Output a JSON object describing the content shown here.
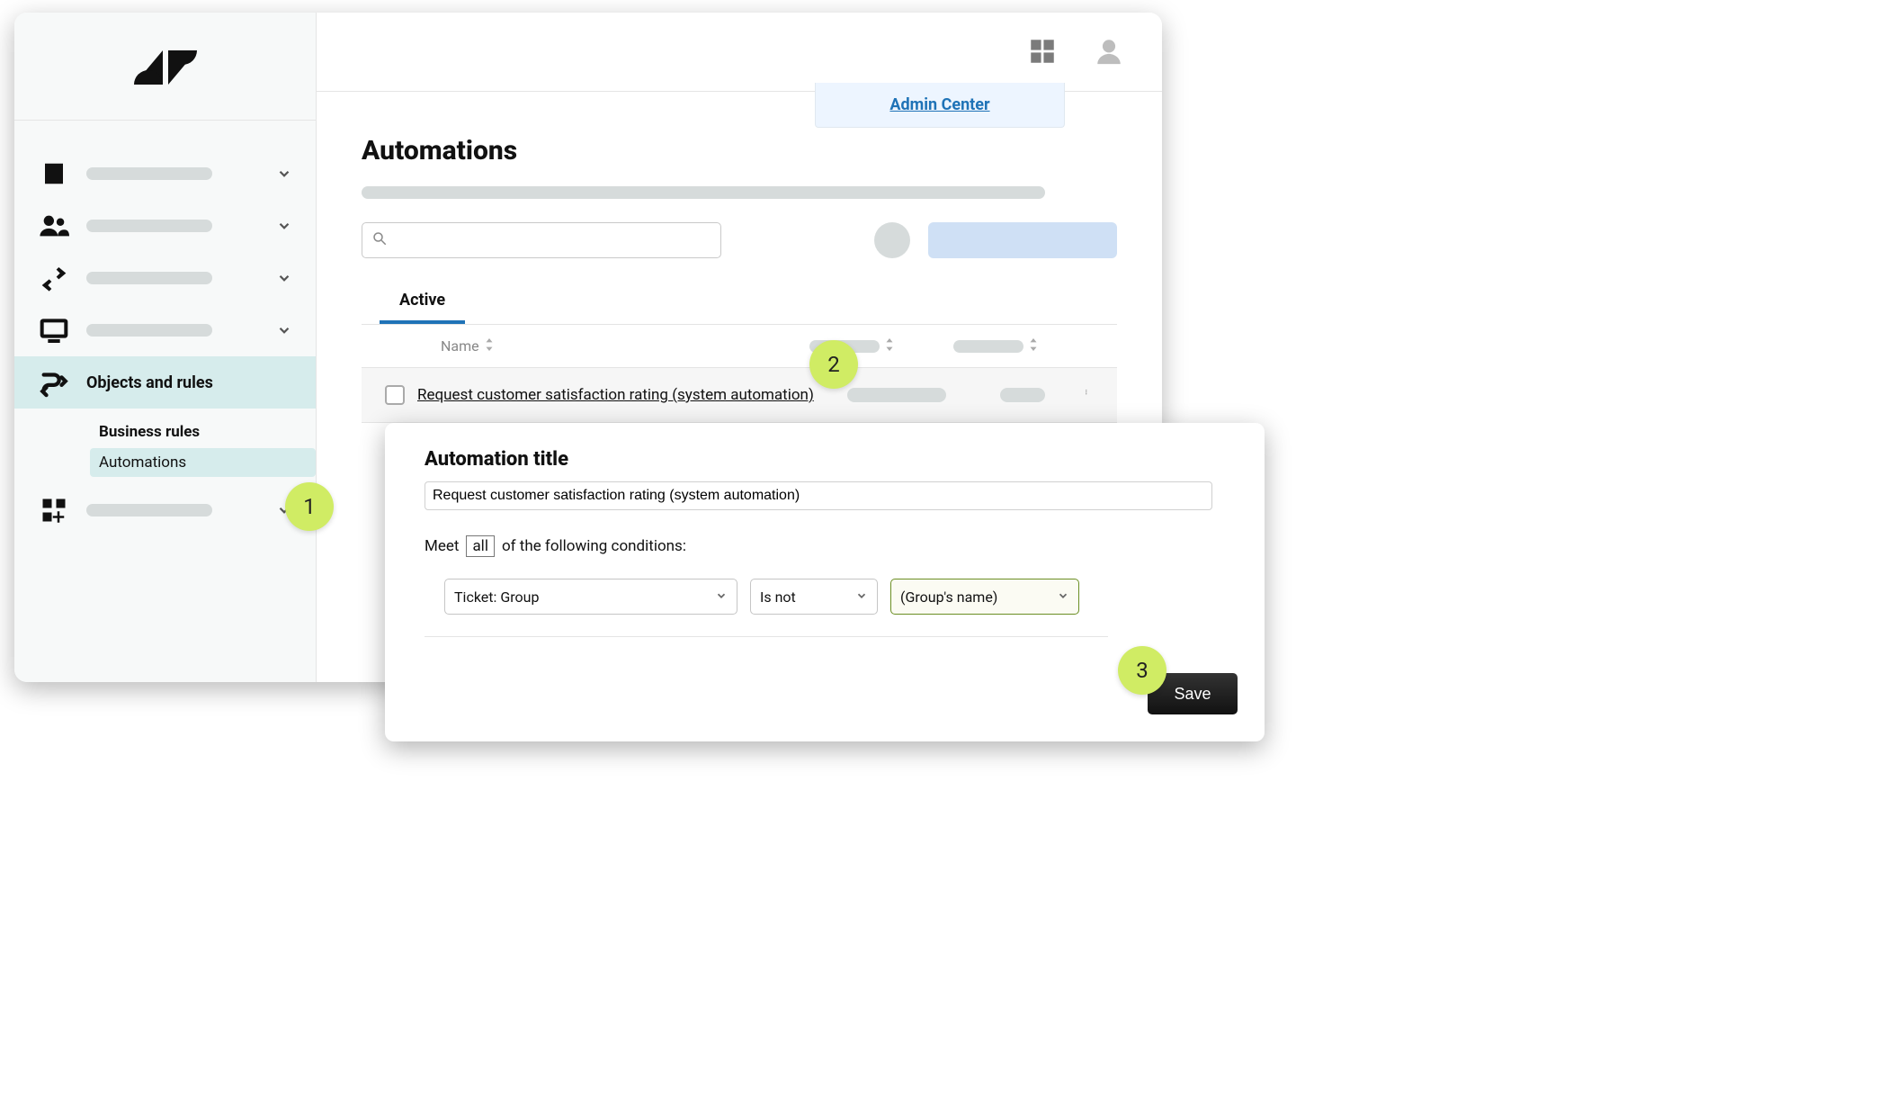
{
  "sidebar": {
    "objects_and_rules_label": "Objects and rules",
    "business_rules_label": "Business rules",
    "automations_label": "Automations"
  },
  "topbar": {
    "admin_center_label": "Admin Center"
  },
  "page": {
    "title": "Automations",
    "active_tab_label": "Active",
    "name_column_label": "Name",
    "row1_name": "Request customer satisfaction rating (system automation)"
  },
  "editor": {
    "heading": "Automation title",
    "title_value": "Request customer satisfaction rating (system automation)",
    "meet_prefix": "Meet",
    "all_word": "all",
    "meet_suffix": "of the following conditions:",
    "cond_field": "Ticket: Group",
    "cond_op": "Is not",
    "cond_value": "(Group's name)",
    "save_label": "Save"
  },
  "callouts": {
    "c1": "1",
    "c2": "2",
    "c3": "3"
  }
}
